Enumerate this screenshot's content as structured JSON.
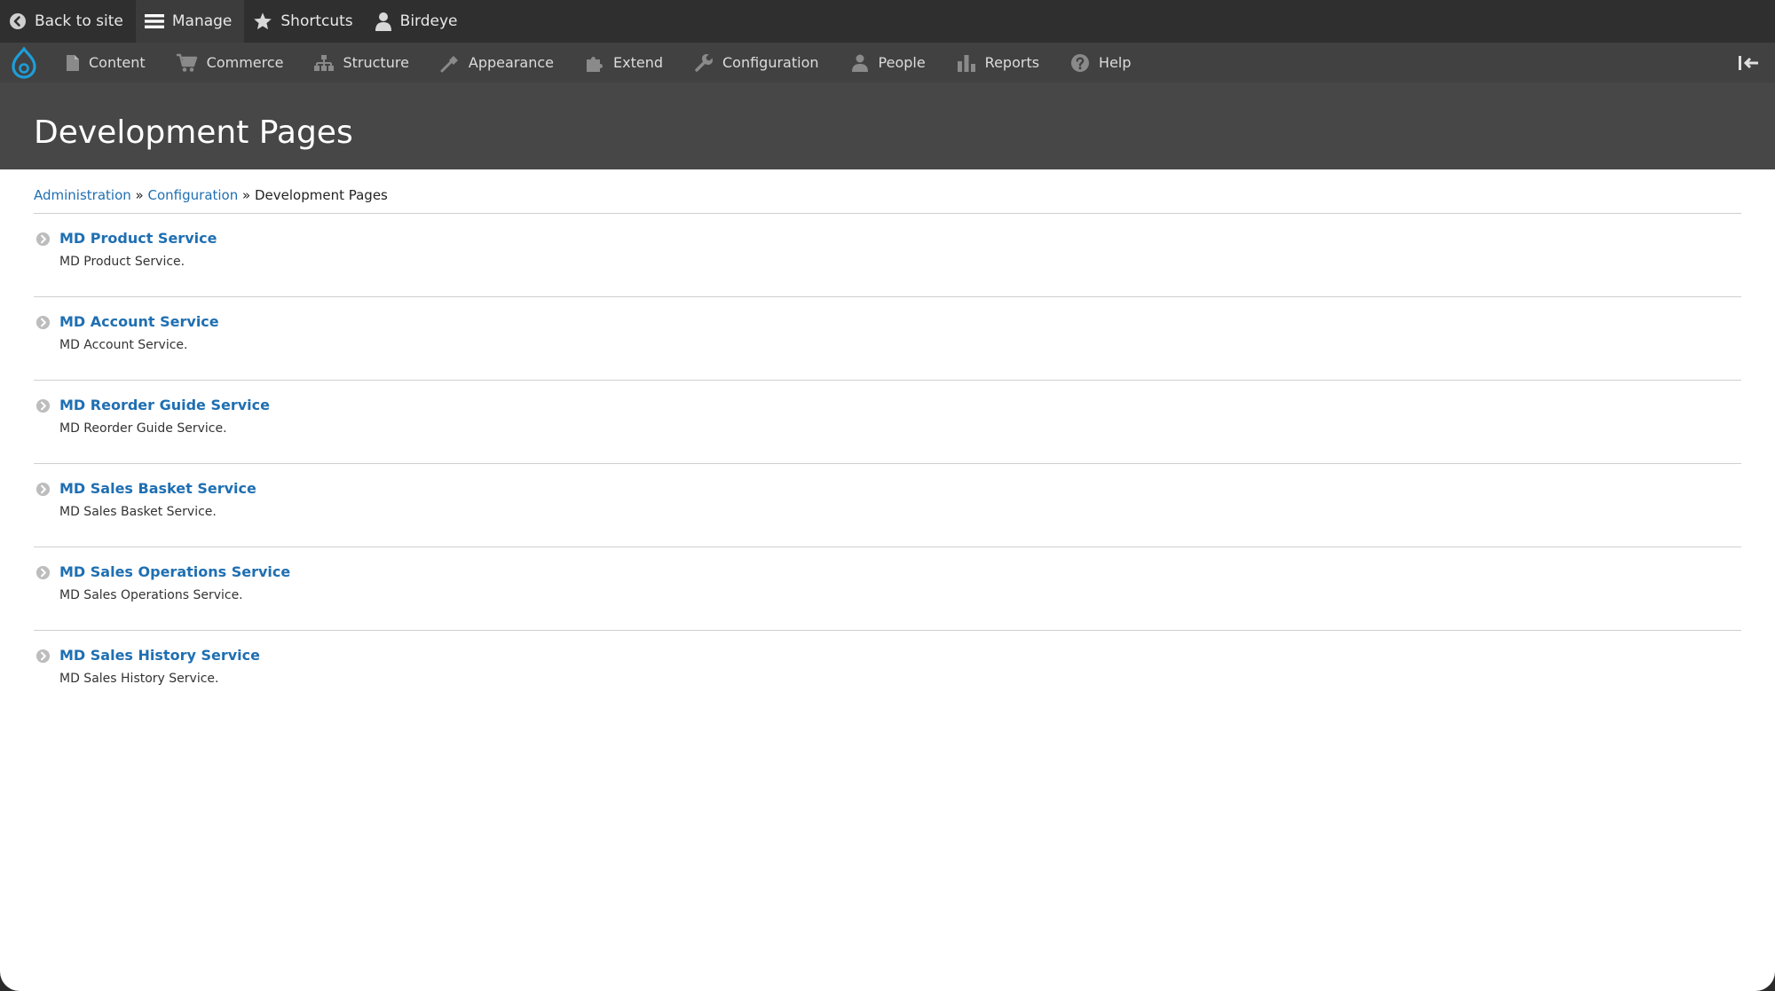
{
  "colors": {
    "toolbar_bg": "#2f2f2f",
    "tray_bg": "#414141",
    "header_bg": "#474747",
    "link": "#1f6fb2",
    "drupal_blue": "#1d9ed9"
  },
  "toolbar": {
    "back": {
      "label": "Back to site",
      "icon": "back-circle-icon"
    },
    "manage": {
      "label": "Manage",
      "icon": "hamburger-icon"
    },
    "shortcuts": {
      "label": "Shortcuts",
      "icon": "star-icon"
    },
    "user": {
      "label": "Birdeye",
      "icon": "user-icon"
    }
  },
  "tray": {
    "items": [
      {
        "label": "Content",
        "icon": "document-icon"
      },
      {
        "label": "Commerce",
        "icon": "cart-icon"
      },
      {
        "label": "Structure",
        "icon": "sitemap-icon"
      },
      {
        "label": "Appearance",
        "icon": "brush-icon"
      },
      {
        "label": "Extend",
        "icon": "puzzle-icon"
      },
      {
        "label": "Configuration",
        "icon": "wrench-icon"
      },
      {
        "label": "People",
        "icon": "people-icon"
      },
      {
        "label": "Reports",
        "icon": "bar-chart-icon"
      },
      {
        "label": "Help",
        "icon": "help-icon"
      }
    ]
  },
  "page": {
    "title": "Development Pages"
  },
  "breadcrumb": {
    "items": [
      "Administration",
      "Configuration"
    ],
    "separator": "»",
    "current": "Development Pages"
  },
  "services": [
    {
      "title": "MD Product Service",
      "description": "MD Product Service."
    },
    {
      "title": "MD Account Service",
      "description": "MD Account Service."
    },
    {
      "title": "MD Reorder Guide Service",
      "description": "MD Reorder Guide Service."
    },
    {
      "title": "MD Sales Basket Service",
      "description": "MD Sales Basket Service."
    },
    {
      "title": "MD Sales Operations Service",
      "description": "MD Sales Operations Service."
    },
    {
      "title": "MD Sales History Service",
      "description": "MD Sales History Service."
    }
  ]
}
